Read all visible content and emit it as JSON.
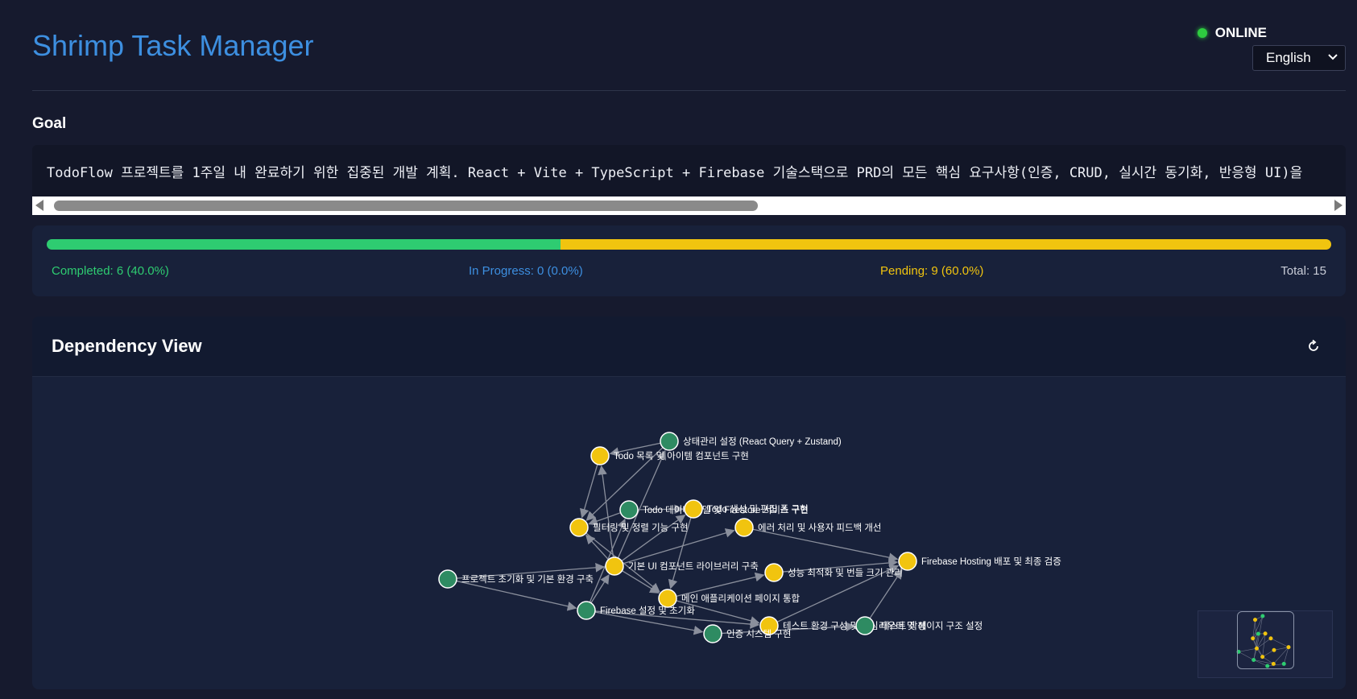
{
  "header": {
    "app_title": "Shrimp Task Manager",
    "status": "ONLINE",
    "language": "English"
  },
  "goal": {
    "heading": "Goal",
    "text": "TodoFlow 프로젝트를 1주일 내 완료하기 위한 집중된 개발 계획. React + Vite + TypeScript + Firebase 기술스택으로 PRD의 모든 핵심 요구사항(인증, CRUD, 실시간 동기화, 반응형 UI)을"
  },
  "progress": {
    "completed_label": "Completed: 6 (40.0%)",
    "in_progress_label": "In Progress: 0 (0.0%)",
    "pending_label": "Pending: 9 (60.0%)",
    "total_label": "Total: 15",
    "completed_fraction": 0.4,
    "in_progress_fraction": 0.0,
    "pending_fraction": 0.6
  },
  "dependency_view": {
    "title": "Dependency View",
    "refresh_icon": "refresh-icon",
    "colors": {
      "completed": "#2e8b62",
      "pending": "#f1c40f",
      "edge": "#8a8f9c"
    },
    "nodes": [
      {
        "id": "n1",
        "label": "상태관리 설정 (React Query + Zustand)",
        "status": "completed"
      },
      {
        "id": "n2",
        "label": "Todo 목록 및 아이템 컴포넌트 구현",
        "status": "pending"
      },
      {
        "id": "n3",
        "label": "Todo 데이터 모델 및 Firestore 서비스 구현",
        "status": "completed"
      },
      {
        "id": "n4",
        "label": "Todo 생성 및 편집 폼 구현",
        "status": "pending"
      },
      {
        "id": "n5",
        "label": "필터링 및 정렬 기능 구현",
        "status": "pending"
      },
      {
        "id": "n6",
        "label": "에러 처리 및 사용자 피드백 개선",
        "status": "pending"
      },
      {
        "id": "n7",
        "label": "Firebase Hosting 배포 및 최종 검증",
        "status": "pending"
      },
      {
        "id": "n8",
        "label": "기본 UI 컴포넌트 라이브러리 구축",
        "status": "pending"
      },
      {
        "id": "n9",
        "label": "성능 최적화 및 번들 크기 관리",
        "status": "pending"
      },
      {
        "id": "n10",
        "label": "프로젝트 초기화 및 기본 환경 구축",
        "status": "completed"
      },
      {
        "id": "n11",
        "label": "메인 애플리케이션 페이지 통합",
        "status": "pending"
      },
      {
        "id": "n12",
        "label": "Firebase 설정 및 초기화",
        "status": "completed"
      },
      {
        "id": "n13",
        "label": "테스트 환경 구성 및 핵심 테스트 작성",
        "status": "pending"
      },
      {
        "id": "n14",
        "label": "라우터 및 페이지 구조 설정",
        "status": "completed"
      },
      {
        "id": "n15",
        "label": "인증 시스템 구현",
        "status": "completed"
      }
    ],
    "edges": [
      [
        "n10",
        "n8"
      ],
      [
        "n10",
        "n12"
      ],
      [
        "n12",
        "n8"
      ],
      [
        "n12",
        "n15"
      ],
      [
        "n12",
        "n3"
      ],
      [
        "n8",
        "n2"
      ],
      [
        "n8",
        "n5"
      ],
      [
        "n8",
        "n4"
      ],
      [
        "n8",
        "n6"
      ],
      [
        "n8",
        "n11"
      ],
      [
        "n8",
        "n1"
      ],
      [
        "n1",
        "n2"
      ],
      [
        "n1",
        "n5"
      ],
      [
        "n3",
        "n5"
      ],
      [
        "n3",
        "n4"
      ],
      [
        "n2",
        "n5"
      ],
      [
        "n4",
        "n11"
      ],
      [
        "n5",
        "n11"
      ],
      [
        "n11",
        "n9"
      ],
      [
        "n11",
        "n13"
      ],
      [
        "n6",
        "n7"
      ],
      [
        "n9",
        "n7"
      ],
      [
        "n13",
        "n7"
      ],
      [
        "n14",
        "n7"
      ],
      [
        "n15",
        "n14"
      ],
      [
        "n12",
        "n13"
      ]
    ]
  }
}
